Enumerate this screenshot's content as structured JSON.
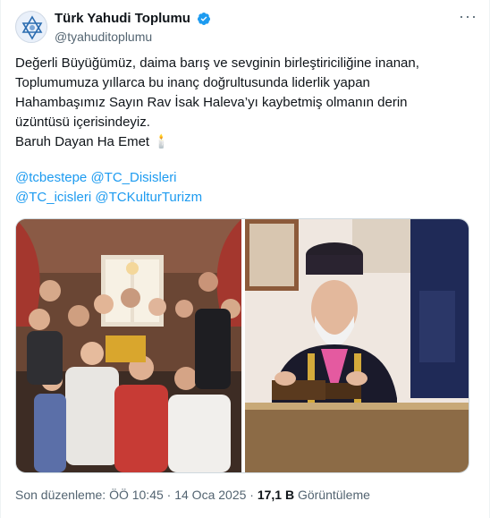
{
  "account": {
    "display_name": "Türk Yahudi Toplumu",
    "handle": "@tyahuditoplumu",
    "avatar_icon": "star-of-david-icon",
    "verified_icon": "verified-badge-icon",
    "verified_color": "#1d9bf0"
  },
  "menu": {
    "more_icon": "more-horizontal-icon",
    "more_label": "···"
  },
  "tweet": {
    "lines": [
      "Değerli Büyüğümüz, daima barış ve sevginin birleştiriciliğine inanan,",
      "Toplumumuza yıllarca bu inanç doğrultusunda liderlik yapan",
      "Hahambaşımız Sayın Rav İsak Haleva’yı kaybetmiş olmanın derin",
      "üzüntüsü içerisindeyiz.",
      "Baruh Dayan Ha Emet 🕯️"
    ],
    "mentions_line1": [
      "@tcbestepe",
      "@TC_Disisleri"
    ],
    "mentions_line2": [
      "@TC_icisleri",
      "@TCKulturTurizm"
    ]
  },
  "media": {
    "photos": [
      "family-group-photo",
      "rabbi-portrait-photo"
    ]
  },
  "meta": {
    "edited_label": "Son düzenleme: ÖÖ 10:45 · 14 Oca 2025 ·",
    "views_count": "17,1 B",
    "views_label": "Görüntüleme"
  },
  "colors": {
    "link": "#1d9bf0",
    "text": "#0f1419",
    "secondary": "#536471"
  }
}
